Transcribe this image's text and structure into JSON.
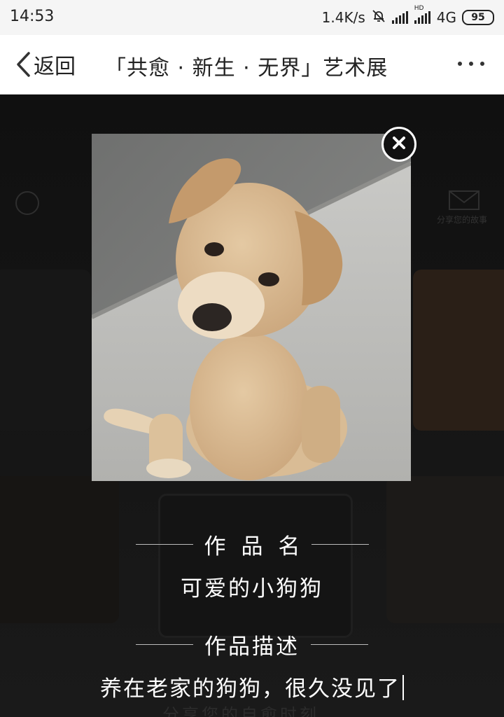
{
  "status_bar": {
    "time": "14:53",
    "net_speed": "1.4K/s",
    "network": "4G",
    "hd_badge": "HD",
    "battery": "95",
    "icons": [
      "mute-bell-icon",
      "signal-icon",
      "signal-icon",
      "battery-icon"
    ]
  },
  "title_bar": {
    "back_label": "返回",
    "title": "「共愈 · 新生 · 无界」艺术展",
    "more_icon": "more-dots-icon"
  },
  "background": {
    "envelope_label": "分享您的故事",
    "footer_text": "分享您的自愈时刻"
  },
  "modal": {
    "photo_icon": "puppy-photo",
    "close_icon": "close-icon",
    "name_heading": "作品名",
    "work_name": "可爱的小狗狗",
    "desc_heading": "作品描述",
    "work_description": "养在老家的狗狗，很久没见了"
  },
  "colors": {
    "overlay": "#0c0c0c",
    "title_bar_bg": "#ffffff",
    "status_bar_bg": "#f5f5f5",
    "text_on_dark": "#ffffff"
  }
}
